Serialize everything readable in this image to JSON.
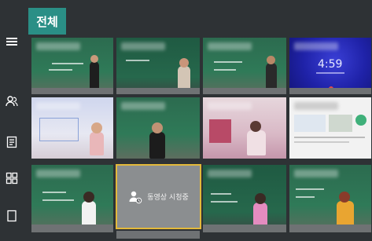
{
  "tab": {
    "label": "전체"
  },
  "sidebar": {
    "icons": [
      {
        "name": "menu-icon"
      },
      {
        "name": "people-icon"
      },
      {
        "name": "document-list-icon"
      },
      {
        "name": "grid-view-icon"
      },
      {
        "name": "single-view-icon"
      }
    ]
  },
  "tiles": {
    "waiting_label": "동영상 시청중",
    "clock_time": "4:59"
  },
  "colors": {
    "accent": "#2a8f86",
    "highlight_border": "#e3b93a",
    "background": "#2e3235"
  }
}
